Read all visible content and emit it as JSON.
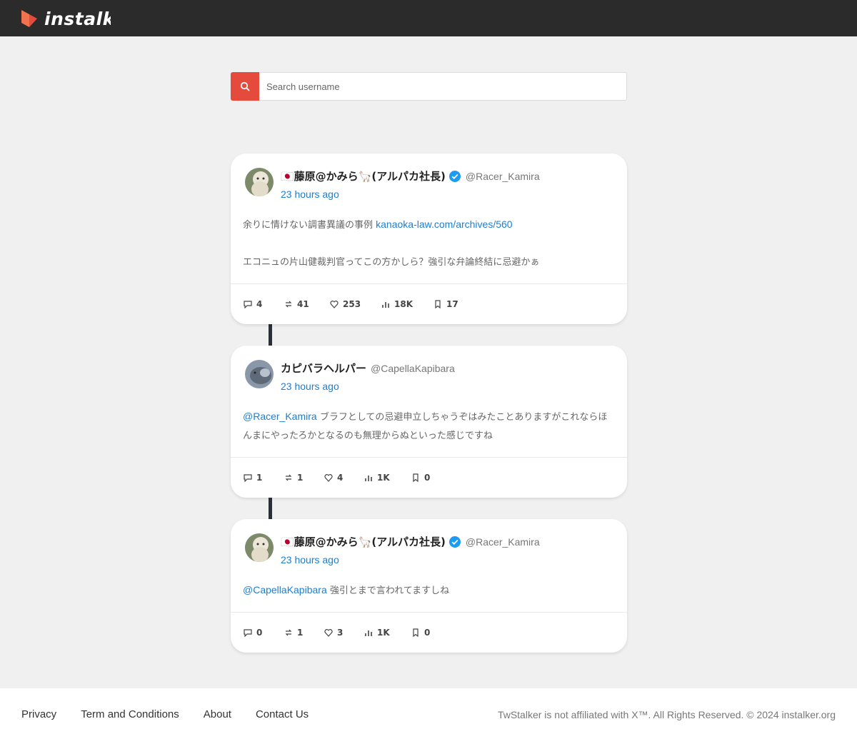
{
  "brand": {
    "name": "instalker",
    "accent": "#e54b3c"
  },
  "search": {
    "placeholder": "Search username",
    "icon": "search-icon"
  },
  "posts": [
    {
      "display_name": "🇯🇵藤原@かみら🦙(アルパカ社長)",
      "verified": true,
      "handle": "@Racer_Kamira",
      "time": "23 hours ago",
      "text_parts": [
        {
          "text": "余りに情けない調書異議の事例 "
        },
        {
          "link": "kanaoka-law.com/archives/560"
        }
      ],
      "text2": "エコニュの片山健裁判官ってこの方かしら？強引な弁論終結に忌避かぁ",
      "stats": {
        "replies": "4",
        "retweets": "41",
        "likes": "253",
        "views": "18K",
        "bookmarks": "17"
      }
    },
    {
      "display_name": "カピバラヘルパー",
      "verified": false,
      "handle": "@CapellaKapibara",
      "time": "23 hours ago",
      "mention": "@Racer_Kamira",
      "text": " ブラフとしての忌避申立しちゃうぞはみたことありますがこれならほんまにやったろかとなるのも無理からぬといった感じですね",
      "stats": {
        "replies": "1",
        "retweets": "1",
        "likes": "4",
        "views": "1K",
        "bookmarks": "0"
      }
    },
    {
      "display_name": "🇯🇵藤原@かみら🦙(アルパカ社長)",
      "verified": true,
      "handle": "@Racer_Kamira",
      "time": "23 hours ago",
      "mention": "@CapellaKapibara",
      "text": " 強引とまで言われてますしね",
      "stats": {
        "replies": "0",
        "retweets": "1",
        "likes": "3",
        "views": "1K",
        "bookmarks": "0"
      }
    }
  ],
  "footer": {
    "links": [
      "Privacy",
      "Term and Conditions",
      "About",
      "Contact Us"
    ],
    "notice": "TwStalker is not affiliated with X™. All Rights Reserved. © 2024 instalker.org"
  }
}
